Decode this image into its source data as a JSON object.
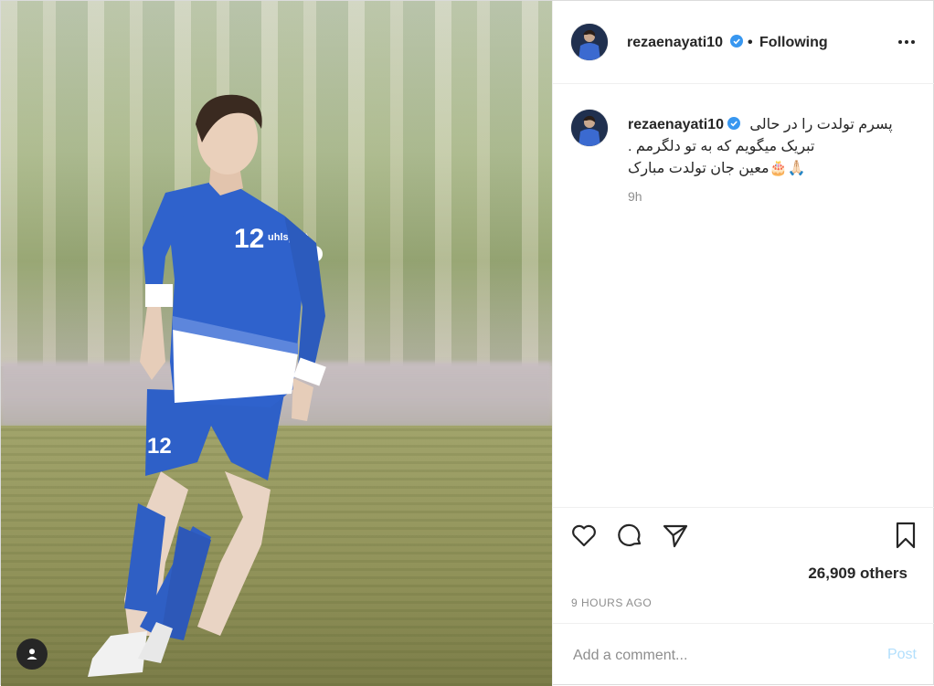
{
  "post": {
    "username": "rezaenayati10",
    "follow_separator": "•",
    "follow_status": "Following",
    "caption_lines": [
      "پسرم تولدت را در حالی",
      "تبریک میگویم که به تو دلگرمم .",
      "🙏🏻🎂معین جان تولدت مبارک"
    ],
    "caption_time": "9h",
    "likes": "26,909 others",
    "posted_time": "9 HOURS AGO",
    "comment_placeholder": "Add a comment...",
    "post_button": "Post"
  },
  "icons": {
    "verified": "verified-badge-icon",
    "more": "more-options-icon",
    "like": "heart-icon",
    "comment": "comment-bubble-icon",
    "share": "paper-plane-icon",
    "save": "bookmark-icon",
    "user_tag": "user-tag-icon"
  },
  "colors": {
    "verified": "#3897f0",
    "muted": "#8e8e8e",
    "post_button": "#b2dffc",
    "text": "#262626"
  }
}
